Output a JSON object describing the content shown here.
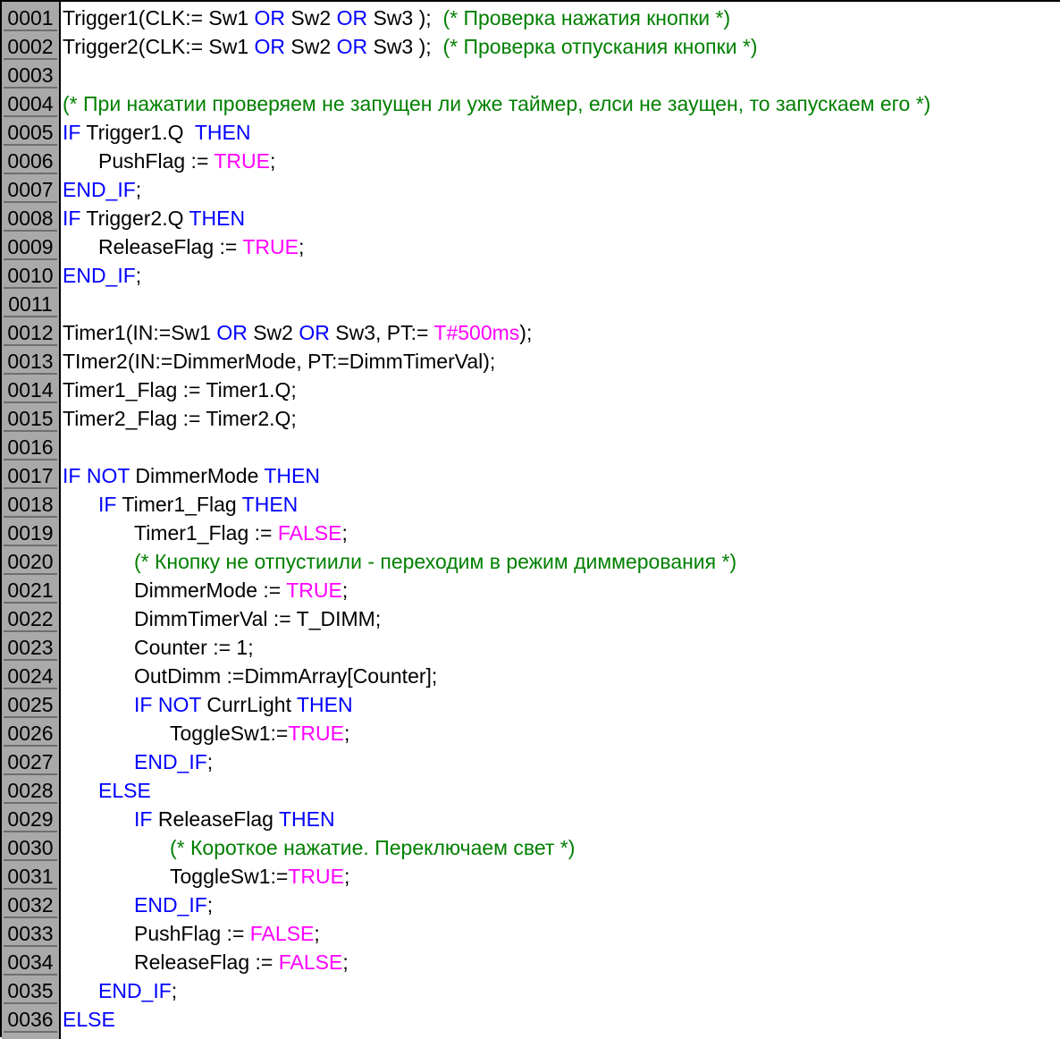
{
  "editor": {
    "colors": {
      "keyword": "#0000ff",
      "literal": "#ff00ff",
      "comment": "#008000",
      "identifier": "#000000",
      "gutter": "#a9a9a9"
    },
    "lines": [
      {
        "num": "0001",
        "indent": 0,
        "tokens": [
          [
            "id",
            "Trigger1(CLK:= Sw1 "
          ],
          [
            "kw",
            "OR"
          ],
          [
            "id",
            " Sw2 "
          ],
          [
            "kw",
            "OR"
          ],
          [
            "id",
            " Sw3 );  "
          ],
          [
            "cm",
            "(* Проверка нажатия кнопки *)"
          ]
        ]
      },
      {
        "num": "0002",
        "indent": 0,
        "tokens": [
          [
            "id",
            "Trigger2(CLK:= Sw1 "
          ],
          [
            "kw",
            "OR"
          ],
          [
            "id",
            " Sw2 "
          ],
          [
            "kw",
            "OR"
          ],
          [
            "id",
            " Sw3 );  "
          ],
          [
            "cm",
            "(* Проверка отпускания кнопки *)"
          ]
        ]
      },
      {
        "num": "0003",
        "indent": 0,
        "tokens": []
      },
      {
        "num": "0004",
        "indent": 0,
        "tokens": [
          [
            "cm",
            "(* При нажатии проверяем не запущен ли уже таймер, елси не заущен, то запускаем его *)"
          ]
        ]
      },
      {
        "num": "0005",
        "indent": 0,
        "tokens": [
          [
            "kw",
            "IF"
          ],
          [
            "id",
            " Trigger1.Q  "
          ],
          [
            "kw",
            "THEN"
          ]
        ]
      },
      {
        "num": "0006",
        "indent": 1,
        "tokens": [
          [
            "id",
            "PushFlag := "
          ],
          [
            "lit",
            "TRUE"
          ],
          [
            "id",
            ";"
          ]
        ]
      },
      {
        "num": "0007",
        "indent": 0,
        "tokens": [
          [
            "kw",
            "END_IF"
          ],
          [
            "id",
            ";"
          ]
        ]
      },
      {
        "num": "0008",
        "indent": 0,
        "tokens": [
          [
            "kw",
            "IF"
          ],
          [
            "id",
            " Trigger2.Q "
          ],
          [
            "kw",
            "THEN"
          ]
        ]
      },
      {
        "num": "0009",
        "indent": 1,
        "tokens": [
          [
            "id",
            "ReleaseFlag := "
          ],
          [
            "lit",
            "TRUE"
          ],
          [
            "id",
            ";"
          ]
        ]
      },
      {
        "num": "0010",
        "indent": 0,
        "tokens": [
          [
            "kw",
            "END_IF"
          ],
          [
            "id",
            ";"
          ]
        ]
      },
      {
        "num": "0011",
        "indent": 0,
        "tokens": []
      },
      {
        "num": "0012",
        "indent": 0,
        "tokens": [
          [
            "id",
            "Timer1(IN:=Sw1 "
          ],
          [
            "kw",
            "OR"
          ],
          [
            "id",
            " Sw2 "
          ],
          [
            "kw",
            "OR"
          ],
          [
            "id",
            " Sw3, PT:= "
          ],
          [
            "lit",
            "T#500ms"
          ],
          [
            "id",
            ");"
          ]
        ]
      },
      {
        "num": "0013",
        "indent": 0,
        "tokens": [
          [
            "id",
            "TImer2(IN:=DimmerMode, PT:=DimmTimerVal);"
          ]
        ]
      },
      {
        "num": "0014",
        "indent": 0,
        "tokens": [
          [
            "id",
            "Timer1_Flag := Timer1.Q;"
          ]
        ]
      },
      {
        "num": "0015",
        "indent": 0,
        "tokens": [
          [
            "id",
            "Timer2_Flag := Timer2.Q;"
          ]
        ]
      },
      {
        "num": "0016",
        "indent": 0,
        "tokens": []
      },
      {
        "num": "0017",
        "indent": 0,
        "tokens": [
          [
            "kw",
            "IF NOT"
          ],
          [
            "id",
            " DimmerMode "
          ],
          [
            "kw",
            "THEN"
          ]
        ]
      },
      {
        "num": "0018",
        "indent": 1,
        "tokens": [
          [
            "kw",
            "IF"
          ],
          [
            "id",
            " Timer1_Flag "
          ],
          [
            "kw",
            "THEN"
          ]
        ]
      },
      {
        "num": "0019",
        "indent": 2,
        "tokens": [
          [
            "id",
            "Timer1_Flag := "
          ],
          [
            "lit",
            "FALSE"
          ],
          [
            "id",
            ";"
          ]
        ]
      },
      {
        "num": "0020",
        "indent": 2,
        "tokens": [
          [
            "cm",
            "(* Кнопку не отпустиили - переходим в режим диммерования *)"
          ]
        ]
      },
      {
        "num": "0021",
        "indent": 2,
        "tokens": [
          [
            "id",
            "DimmerMode := "
          ],
          [
            "lit",
            "TRUE"
          ],
          [
            "id",
            ";"
          ]
        ]
      },
      {
        "num": "0022",
        "indent": 2,
        "tokens": [
          [
            "id",
            "DimmTimerVal := T_DIMM;"
          ]
        ]
      },
      {
        "num": "0023",
        "indent": 2,
        "tokens": [
          [
            "id",
            "Counter := 1;"
          ]
        ]
      },
      {
        "num": "0024",
        "indent": 2,
        "tokens": [
          [
            "id",
            "OutDimm :=DimmArray[Counter];"
          ]
        ]
      },
      {
        "num": "0025",
        "indent": 2,
        "tokens": [
          [
            "kw",
            "IF NOT"
          ],
          [
            "id",
            " CurrLight "
          ],
          [
            "kw",
            "THEN"
          ]
        ]
      },
      {
        "num": "0026",
        "indent": 3,
        "tokens": [
          [
            "id",
            "ToggleSw1:="
          ],
          [
            "lit",
            "TRUE"
          ],
          [
            "id",
            ";"
          ]
        ]
      },
      {
        "num": "0027",
        "indent": 2,
        "tokens": [
          [
            "kw",
            "END_IF"
          ],
          [
            "id",
            ";"
          ]
        ]
      },
      {
        "num": "0028",
        "indent": 1,
        "tokens": [
          [
            "kw",
            "ELSE"
          ]
        ]
      },
      {
        "num": "0029",
        "indent": 2,
        "tokens": [
          [
            "kw",
            "IF"
          ],
          [
            "id",
            " ReleaseFlag "
          ],
          [
            "kw",
            "THEN"
          ]
        ]
      },
      {
        "num": "0030",
        "indent": 3,
        "tokens": [
          [
            "cm",
            "(* Короткое нажатие. Переключаем свет *)"
          ]
        ]
      },
      {
        "num": "0031",
        "indent": 3,
        "tokens": [
          [
            "id",
            "ToggleSw1:="
          ],
          [
            "lit",
            "TRUE"
          ],
          [
            "id",
            ";"
          ]
        ]
      },
      {
        "num": "0032",
        "indent": 2,
        "tokens": [
          [
            "kw",
            "END_IF"
          ],
          [
            "id",
            ";"
          ]
        ]
      },
      {
        "num": "0033",
        "indent": 2,
        "tokens": [
          [
            "id",
            "PushFlag := "
          ],
          [
            "lit",
            "FALSE"
          ],
          [
            "id",
            ";"
          ]
        ]
      },
      {
        "num": "0034",
        "indent": 2,
        "tokens": [
          [
            "id",
            "ReleaseFlag := "
          ],
          [
            "lit",
            "FALSE"
          ],
          [
            "id",
            ";"
          ]
        ]
      },
      {
        "num": "0035",
        "indent": 1,
        "tokens": [
          [
            "kw",
            "END_IF"
          ],
          [
            "id",
            ";"
          ]
        ]
      },
      {
        "num": "0036",
        "indent": 0,
        "tokens": [
          [
            "kw",
            "ELSE"
          ]
        ]
      }
    ]
  }
}
